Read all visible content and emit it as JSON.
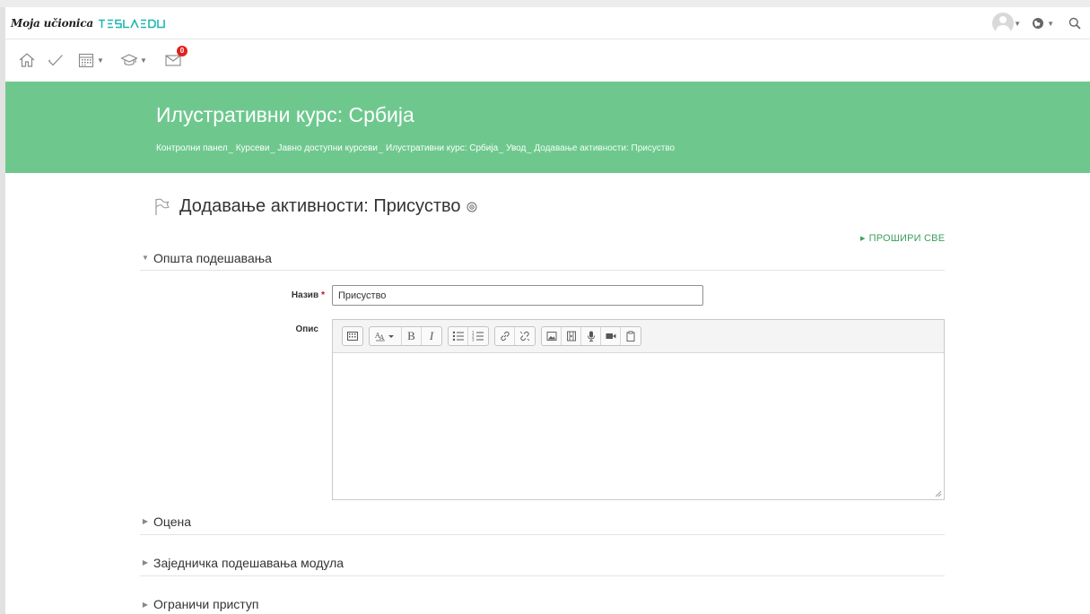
{
  "brand": {
    "script_text": "Moja učionica",
    "logo_text": "TESLAEDU",
    "logo_color": "#1fb7b0"
  },
  "navbar": {
    "avatar_icon": "user-avatar",
    "language_icon": "globe-icon",
    "search_icon": "search-icon"
  },
  "toolbar": {
    "items": [
      "home-icon",
      "check-icon",
      "calendar-icon",
      "graduation-cap-icon",
      "mail-icon"
    ],
    "messages_count": "0"
  },
  "header": {
    "course_title": "Илустративни курс: Србија",
    "breadcrumbs": [
      "Контролни панел",
      "Курсеви",
      "Јавно доступни курсеви",
      "Илустративни курс: Србија",
      "Увод",
      "Додавање активности: Присуство"
    ],
    "background_color": "#6ec88e"
  },
  "main": {
    "page_heading": "Додавање активности: Присуство",
    "expand_all": "ПРОШИРИ СВЕ",
    "sections": {
      "general": "Општа подешавања",
      "grade": "Оцена",
      "common_module": "Заједничка подешавања модула",
      "restrict_access": "Ограничи приступ"
    },
    "fields": {
      "name_label": "Назив",
      "name_value": "Присуство",
      "required_mark": "*",
      "description_label": "Опис"
    },
    "editor_buttons": {
      "bold": "B",
      "italic": "I"
    }
  }
}
